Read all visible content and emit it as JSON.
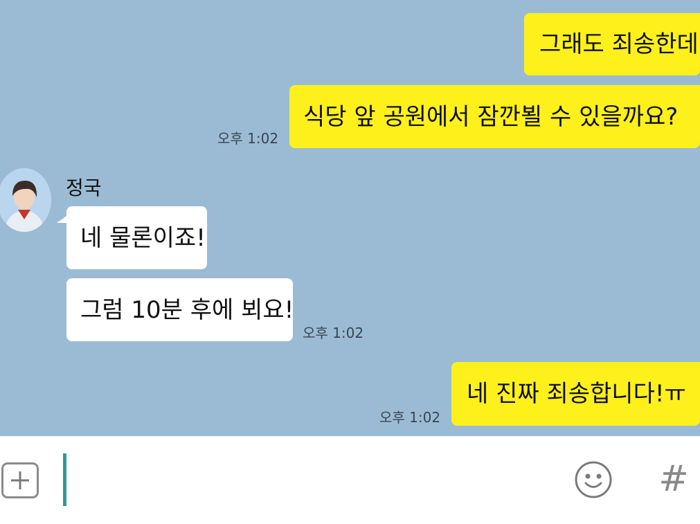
{
  "messages": [
    {
      "side": "mine",
      "text": "그래도 죄송한데"
    },
    {
      "side": "mine",
      "text": "식당 앞 공원에서 잠깐뵐 수 있을까요?",
      "time": "오후 1:02"
    },
    {
      "side": "theirs",
      "sender": "정국",
      "text": "네 물론이죠!"
    },
    {
      "side": "theirs",
      "text": "그럼 10분 후에 뵈요!",
      "time": "오후 1:02"
    },
    {
      "side": "mine",
      "text": "네 진짜 죄송합니다!ㅠ",
      "time": "오후 1:02"
    }
  ],
  "input_bar": {
    "plus_icon": "plus-icon",
    "emoji_icon": "smiley-icon",
    "hash_label": "#",
    "message_value": ""
  },
  "colors": {
    "chat_background": "#9bbbd4",
    "my_bubble": "#fef01b",
    "their_bubble": "#ffffff",
    "cursor": "#2f9a8f"
  }
}
